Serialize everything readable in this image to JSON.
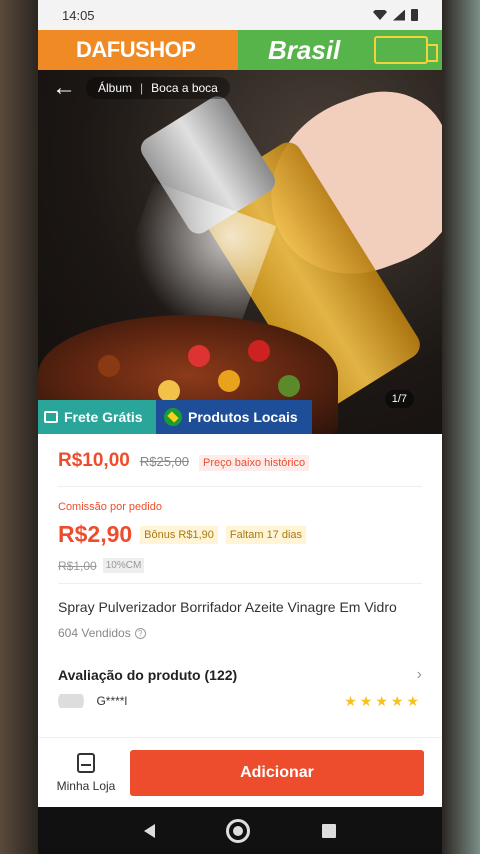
{
  "status_bar": {
    "time": "14:05"
  },
  "hero": {
    "brand_left": "DAFUSHOP",
    "brand_right": "Brasil",
    "tabs": [
      "Álbum",
      "Boca a boca"
    ],
    "image_counter": "1/7",
    "badges": {
      "frete": "Frete Grátis",
      "locais": "Produtos Locais"
    }
  },
  "pricing": {
    "price": "R$10,00",
    "old_price": "R$25,00",
    "price_tag": "Preço baixo histórico"
  },
  "commission": {
    "label": "Comissão por pedido",
    "value": "R$2,90",
    "bonus": "Bônus R$1,90",
    "remaining": "Faltam 17 dias",
    "old_value": "R$1,00",
    "rate": "10%CM"
  },
  "product": {
    "title": "Spray Pulverizador Borrifador Azeite Vinagre Em Vidro",
    "sold": "604 Vendidos"
  },
  "review": {
    "title": "Avaliação do produto (122)",
    "reviewer": "G****l",
    "stars": "★★★★★"
  },
  "bottom_bar": {
    "store_label": "Minha Loja",
    "add_label": "Adicionar"
  },
  "colors": {
    "accent": "#ee4d2d",
    "banner_orange": "#f08a24",
    "banner_green": "#57b44a",
    "badge_teal": "#2aa59a",
    "badge_blue": "#1f4e98"
  }
}
